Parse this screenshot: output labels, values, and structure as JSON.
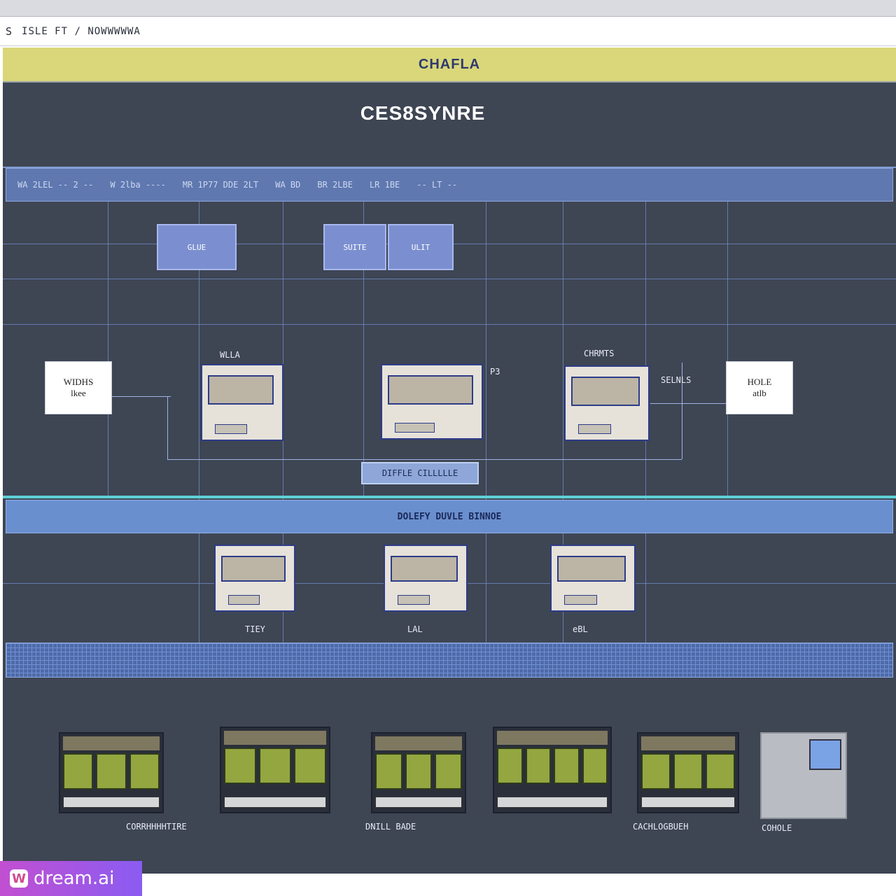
{
  "toolbar": {
    "glyph": "S",
    "path": "ISLE FT / NOWWWWWA"
  },
  "band": {
    "title": "CHAFLA"
  },
  "canvas": {
    "title": "CES8SYNRE",
    "header_segments": [
      "WA 2LEL -- 2 --",
      "W 2lba ----",
      "MR 1P77 DDE 2LT",
      "WA BD",
      "BR 2LBE",
      "LR 1BE",
      "-- LT --"
    ],
    "nodes": [
      {
        "text": "GLUE"
      },
      {
        "text": "SUITE"
      },
      {
        "text": "ULIT"
      }
    ],
    "label_left": {
      "lines": [
        "WIDHS",
        "lkee"
      ]
    },
    "label_right": {
      "lines": [
        "HOLE",
        "atlb"
      ]
    },
    "top_device_labels": [
      "WLLA",
      "CHRMTS"
    ],
    "side_labels": [
      "P3",
      "SELNLS"
    ],
    "mid_button": "DIFFLE CILLLLLE",
    "band_strip": "DOLEFY DUVLE BINNOE",
    "lower_captions": [
      "TIEY",
      "LAL",
      "eBL"
    ],
    "thumb_captions": [
      "CORRHHHHTIRE",
      "DNILL BADE",
      "CACHLOGBUEH",
      "COHOLE"
    ]
  },
  "watermark": {
    "logo": "W",
    "text": "dream.ai"
  }
}
